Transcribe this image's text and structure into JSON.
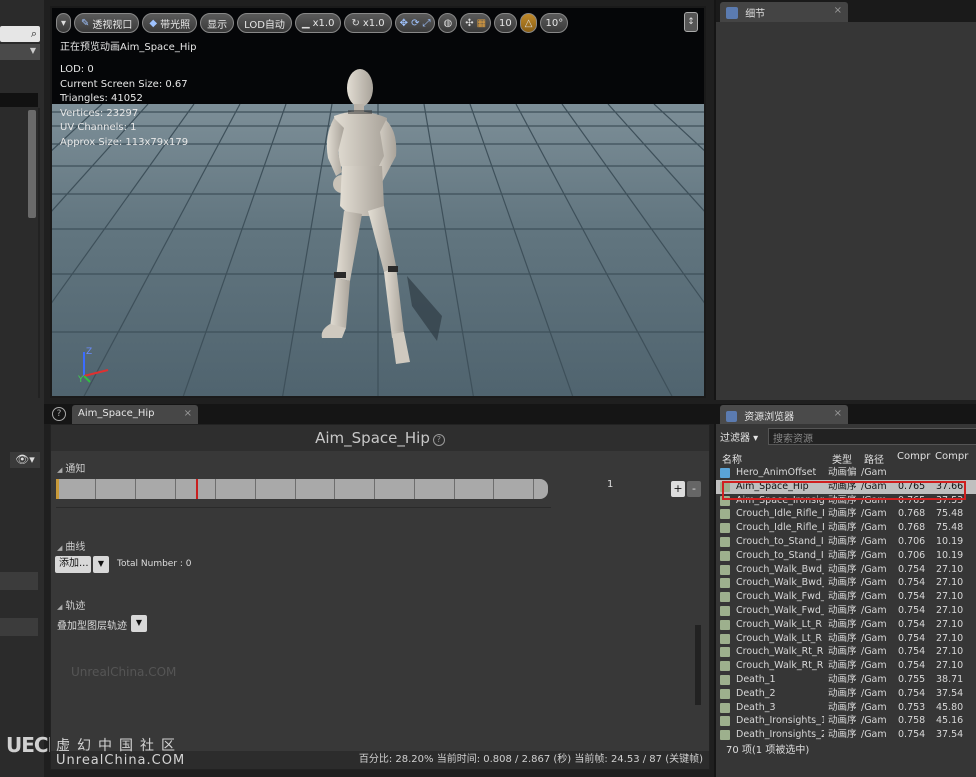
{
  "viewport": {
    "toolbar": {
      "perspective": "透视视口",
      "lighting": "带光照",
      "show": "显示",
      "lod": "LOD自动",
      "speed1": "x1.0",
      "speed2": "x1.0",
      "grid_value": "10",
      "angle_value": "10°"
    },
    "status": "正在预览动画Aim_Space_Hip",
    "info": [
      "LOD: 0",
      "Current Screen Size: 0.67",
      "Triangles: 41052",
      "Vertices: 23297",
      "UV Channels: 1",
      "Approx Size: 113x79x179"
    ],
    "axis": {
      "z": "Z",
      "y": "Y"
    }
  },
  "details": {
    "tab_label": "细节"
  },
  "anim_editor": {
    "tab_label": "Aim_Space_Hip",
    "title": "Aim_Space_Hip",
    "notify_label": "通知",
    "notify_number": "1",
    "curves_label": "曲线",
    "add_label": "添加...",
    "total_number": "Total Number : 0",
    "tracks_label": "轨迹",
    "track_type": "叠加型图层轨迹",
    "watermark": "UnrealChina.COM",
    "status": "百分比: 28.20% 当前时间: 0.808 / 2.867 (秒) 当前帧: 24.53 / 87 (关键帧)"
  },
  "watermark": {
    "cn": "虚幻中国社区",
    "en": "UnrealChina.COM",
    "logo": "UECN"
  },
  "content_browser": {
    "tab_label": "资源浏览器",
    "filter_label": "过滤器",
    "search_placeholder": "搜索资源",
    "headers": {
      "name": "名称",
      "type": "类型",
      "path": "路径",
      "c1": "Compr",
      "c2": "Compr"
    },
    "rows": [
      {
        "name": "Hero_AnimOffset",
        "type": "动画偏",
        "path": "/Gam",
        "c1": "",
        "c2": ""
      },
      {
        "name": "Aim_Space_Hip",
        "type": "动画序",
        "path": "/Gam",
        "c1": "0.765",
        "c2": "37.66"
      },
      {
        "name": "Aim_Space_Ironsig",
        "type": "动画序",
        "path": "/Gam",
        "c1": "0.765",
        "c2": "37.53"
      },
      {
        "name": "Crouch_Idle_Rifle_I",
        "type": "动画序",
        "path": "/Gam",
        "c1": "0.768",
        "c2": "75.48"
      },
      {
        "name": "Crouch_Idle_Rifle_I",
        "type": "动画序",
        "path": "/Gam",
        "c1": "0.768",
        "c2": "75.48"
      },
      {
        "name": "Crouch_to_Stand_I",
        "type": "动画序",
        "path": "/Gam",
        "c1": "0.706",
        "c2": "10.19"
      },
      {
        "name": "Crouch_to_Stand_I",
        "type": "动画序",
        "path": "/Gam",
        "c1": "0.706",
        "c2": "10.19"
      },
      {
        "name": "Crouch_Walk_Bwd_",
        "type": "动画序",
        "path": "/Gam",
        "c1": "0.754",
        "c2": "27.10"
      },
      {
        "name": "Crouch_Walk_Bwd_",
        "type": "动画序",
        "path": "/Gam",
        "c1": "0.754",
        "c2": "27.10"
      },
      {
        "name": "Crouch_Walk_Fwd_",
        "type": "动画序",
        "path": "/Gam",
        "c1": "0.754",
        "c2": "27.10"
      },
      {
        "name": "Crouch_Walk_Fwd_",
        "type": "动画序",
        "path": "/Gam",
        "c1": "0.754",
        "c2": "27.10"
      },
      {
        "name": "Crouch_Walk_Lt_R",
        "type": "动画序",
        "path": "/Gam",
        "c1": "0.754",
        "c2": "27.10"
      },
      {
        "name": "Crouch_Walk_Lt_R",
        "type": "动画序",
        "path": "/Gam",
        "c1": "0.754",
        "c2": "27.10"
      },
      {
        "name": "Crouch_Walk_Rt_R",
        "type": "动画序",
        "path": "/Gam",
        "c1": "0.754",
        "c2": "27.10"
      },
      {
        "name": "Crouch_Walk_Rt_R",
        "type": "动画序",
        "path": "/Gam",
        "c1": "0.754",
        "c2": "27.10"
      },
      {
        "name": "Death_1",
        "type": "动画序",
        "path": "/Gam",
        "c1": "0.755",
        "c2": "38.71"
      },
      {
        "name": "Death_2",
        "type": "动画序",
        "path": "/Gam",
        "c1": "0.754",
        "c2": "37.54"
      },
      {
        "name": "Death_3",
        "type": "动画序",
        "path": "/Gam",
        "c1": "0.753",
        "c2": "45.80"
      },
      {
        "name": "Death_Ironsights_1",
        "type": "动画序",
        "path": "/Gam",
        "c1": "0.758",
        "c2": "45.16"
      },
      {
        "name": "Death_Ironsights_2",
        "type": "动画序",
        "path": "/Gam",
        "c1": "0.754",
        "c2": "37.54"
      }
    ],
    "footer": "70 项(1 项被选中)"
  }
}
